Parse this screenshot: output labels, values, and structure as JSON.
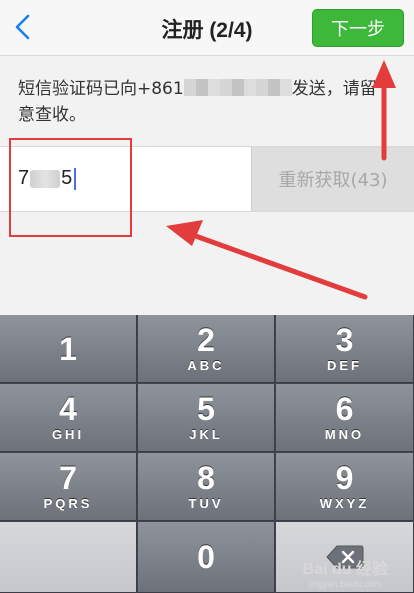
{
  "nav": {
    "title": "注册 (2/4)",
    "next_label": "下一步"
  },
  "message": {
    "prefix": "短信验证码已向+861",
    "suffix": "发送，请留意查收。"
  },
  "code": {
    "visible_start": "7",
    "visible_end": "5"
  },
  "resend": {
    "label": "重新获取(43)"
  },
  "keypad": {
    "keys": [
      {
        "num": "1",
        "letters": ""
      },
      {
        "num": "2",
        "letters": "ABC"
      },
      {
        "num": "3",
        "letters": "DEF"
      },
      {
        "num": "4",
        "letters": "GHI"
      },
      {
        "num": "5",
        "letters": "JKL"
      },
      {
        "num": "6",
        "letters": "MNO"
      },
      {
        "num": "7",
        "letters": "PQRS"
      },
      {
        "num": "8",
        "letters": "TUV"
      },
      {
        "num": "9",
        "letters": "WXYZ"
      },
      {
        "num": "0",
        "letters": ""
      }
    ]
  },
  "watermark": {
    "brand": "Bai du 经验",
    "url": "jingyan.baidu.com"
  },
  "colors": {
    "accent_green": "#3db83a",
    "annotation_red": "#e23c3c",
    "link_blue": "#1a7ff0"
  }
}
